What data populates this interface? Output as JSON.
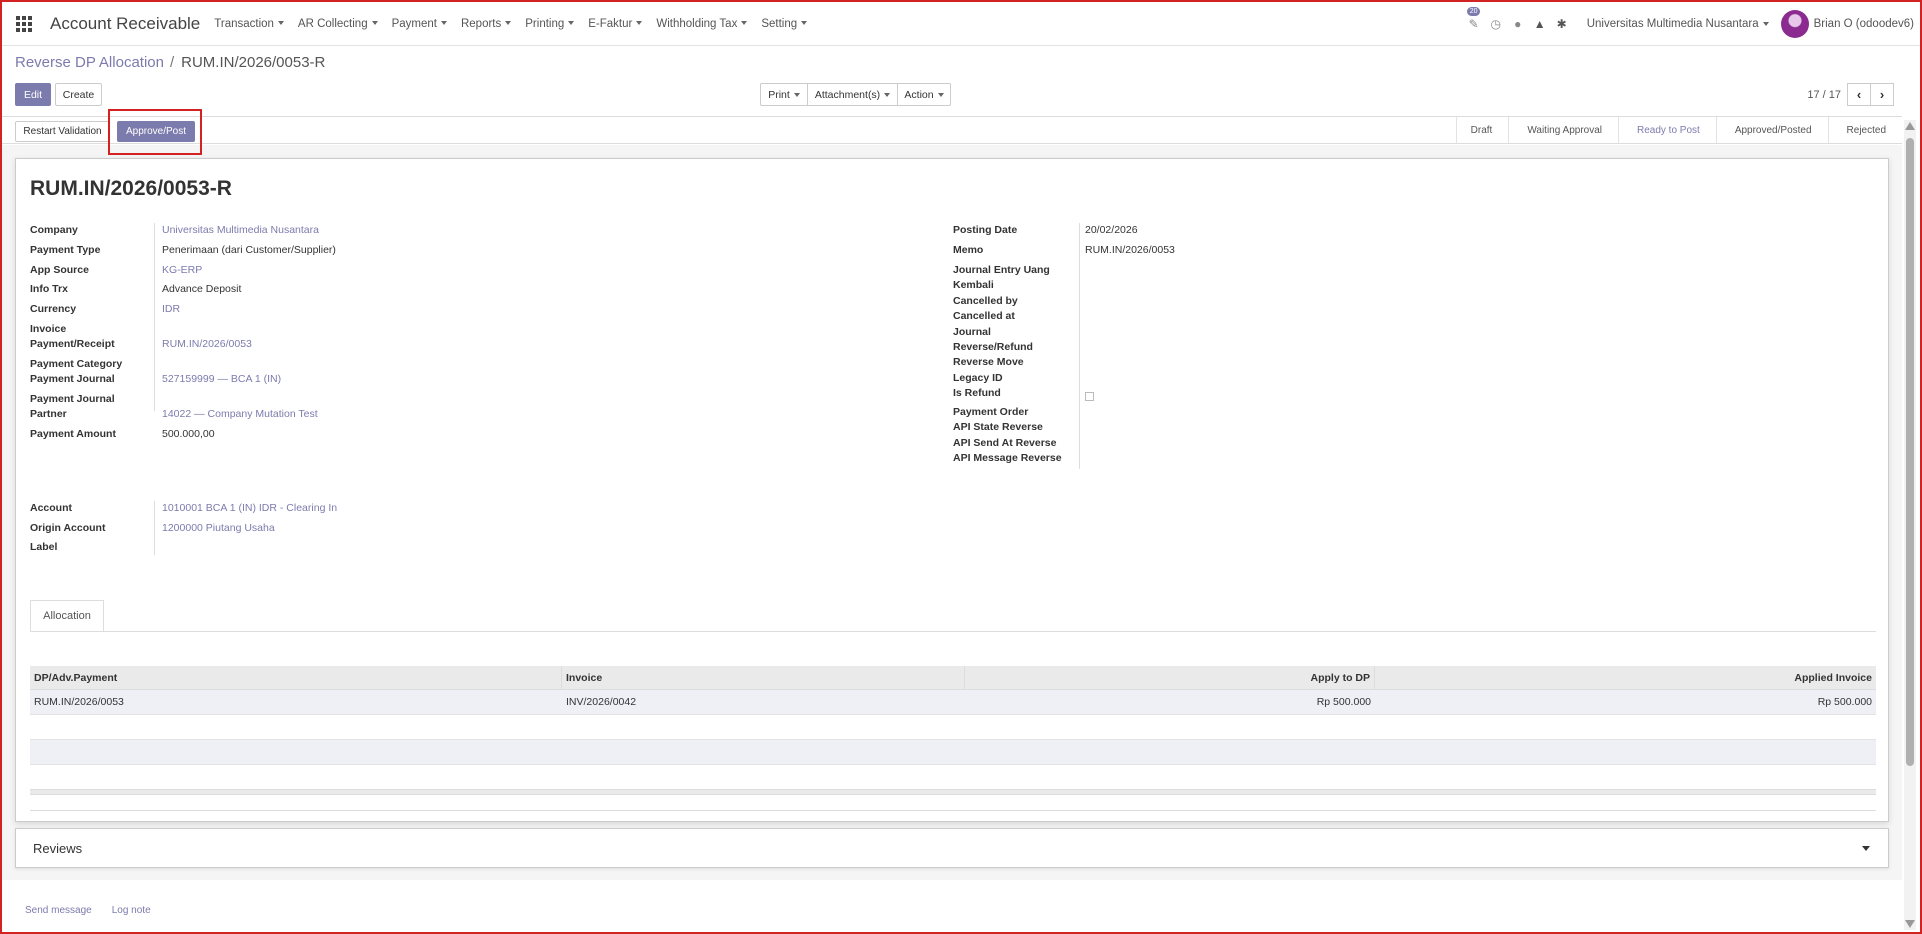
{
  "navbar": {
    "app_title": "Account Receivable",
    "menus": [
      "Transaction",
      "AR Collecting",
      "Payment",
      "Reports",
      "Printing",
      "E-Faktur",
      "Withholding Tax",
      "Setting"
    ],
    "activity_badge": "20",
    "company": "Universitas Multimedia Nusantara",
    "user": "Brian O (odoodev6)"
  },
  "breadcrumb": {
    "parent": "Reverse DP Allocation",
    "separator": "/",
    "current": "RUM.IN/2026/0053-R"
  },
  "toolbar": {
    "edit_label": "Edit",
    "create_label": "Create",
    "print_label": "Print",
    "attachments_label": "Attachment(s)",
    "action_label": "Action",
    "pager_value": "17 / 17"
  },
  "statusbar": {
    "restart_label": "Restart Validation",
    "approve_label": "Approve/Post",
    "stages": [
      "Draft",
      "Waiting Approval",
      "Ready to Post",
      "Approved/Posted",
      "Rejected"
    ],
    "active_stage": "Ready to Post"
  },
  "record": {
    "title": "RUM.IN/2026/0053-R",
    "left": {
      "company_label": "Company",
      "company": "Universitas Multimedia Nusantara",
      "payment_type_label": "Payment Type",
      "payment_type": "Penerimaan (dari Customer/Supplier)",
      "app_source_label": "App Source",
      "app_source": "KG-ERP",
      "info_trx_label": "Info Trx",
      "info_trx": "Advance Deposit",
      "currency_label": "Currency",
      "currency": "IDR",
      "invoice_payment_label_1": "Invoice",
      "invoice_payment_label_2": "Payment/Receipt",
      "invoice_payment": "RUM.IN/2026/0053",
      "payment_category_label": "Payment Category",
      "payment_journal_label": "Payment Journal",
      "payment_journal": "527159999 — BCA 1 (IN)",
      "payment_journal_partner_label_1": "Payment Journal",
      "payment_journal_partner_label_2": "Partner",
      "payment_journal_partner": "14022 — Company Mutation Test",
      "payment_amount_label": "Payment Amount",
      "payment_amount": "500.000,00"
    },
    "right": {
      "posting_date_label": "Posting Date",
      "posting_date": "20/02/2026",
      "memo_label": "Memo",
      "memo": "RUM.IN/2026/0053",
      "je_uang_kembali_label_1": "Journal Entry Uang",
      "je_uang_kembali_label_2": "Kembali",
      "cancelled_by_label": "Cancelled by",
      "cancelled_at_label": "Cancelled at",
      "journal_reverse_label_1": "Journal",
      "journal_reverse_label_2": "Reverse/Refund",
      "reverse_move_label": "Reverse Move",
      "legacy_id_label": "Legacy ID",
      "is_refund_label": "Is Refund",
      "payment_order_label": "Payment Order",
      "api_state_reverse_label": "API State Reverse",
      "api_send_at_reverse_label": "API Send At Reverse",
      "api_message_reverse_label": "API Message Reverse"
    },
    "account": {
      "account_label": "Account",
      "account": "1010001 BCA 1 (IN) IDR - Clearing In",
      "origin_account_label": "Origin Account",
      "origin_account": "1200000 Piutang Usaha",
      "label_label": "Label"
    }
  },
  "notebook": {
    "tab_label": "Allocation",
    "columns": [
      "DP/Adv.Payment",
      "Invoice",
      "Apply to DP",
      "Applied Invoice"
    ],
    "rows": [
      [
        "RUM.IN/2026/0053",
        "INV/2026/0042",
        "Rp 500.000",
        "Rp 500.000"
      ]
    ]
  },
  "reviews": {
    "title": "Reviews"
  },
  "chatter": {
    "send_message": "Send message",
    "log_note": "Log note"
  }
}
